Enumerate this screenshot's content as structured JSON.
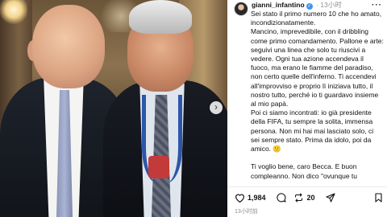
{
  "post": {
    "username": "gianni_infantino",
    "verified_glyph": "✓",
    "separator": "·",
    "time_ago": "13小时",
    "more_glyph": "···",
    "caption_lines": [
      "Sei stato il primo numero 10 che ho amato, incondizionatamente.",
      "Mancino, imprevedibile, con il dribbling come primo comandamento. Pallone e arte: seguivi una linea che solo tu riuscivi a vedere. Ogni tua azione accendeva il fuoco, ma erano le fiamme del paradiso, non certo quelle dell'inferno. Ti accendevi all'improvviso e proprio lì iniziava tutto, il nostro tutto, perché io ti guardavo insieme al mio papà.",
      "Poi ci siamo incontrati: io già presidente della FIFA, tu sempre la solita, immensa persona. Non mi hai mai lasciato solo, ci sei sempre stato. Prima da idolo, poi da amico. 🙂",
      "",
      "Ti voglio bene, caro Becca. E buon compleanno. Non dico \"ovunque tu"
    ],
    "likes": "1,984",
    "comments": "20",
    "timestamp": "13小时前"
  },
  "photo": {
    "next_glyph": "›"
  },
  "icons": {
    "avatar": "avatar-icon",
    "verified": "verified-icon",
    "more": "more-options-icon",
    "next": "chevron-right-icon",
    "like": "heart-icon",
    "comment": "comment-icon",
    "repost": "repost-icon",
    "share": "share-icon",
    "save": "bookmark-icon"
  },
  "colors": {
    "verified": "#3b98f0",
    "muted_text": "#8e8e8e",
    "text": "#111111"
  }
}
